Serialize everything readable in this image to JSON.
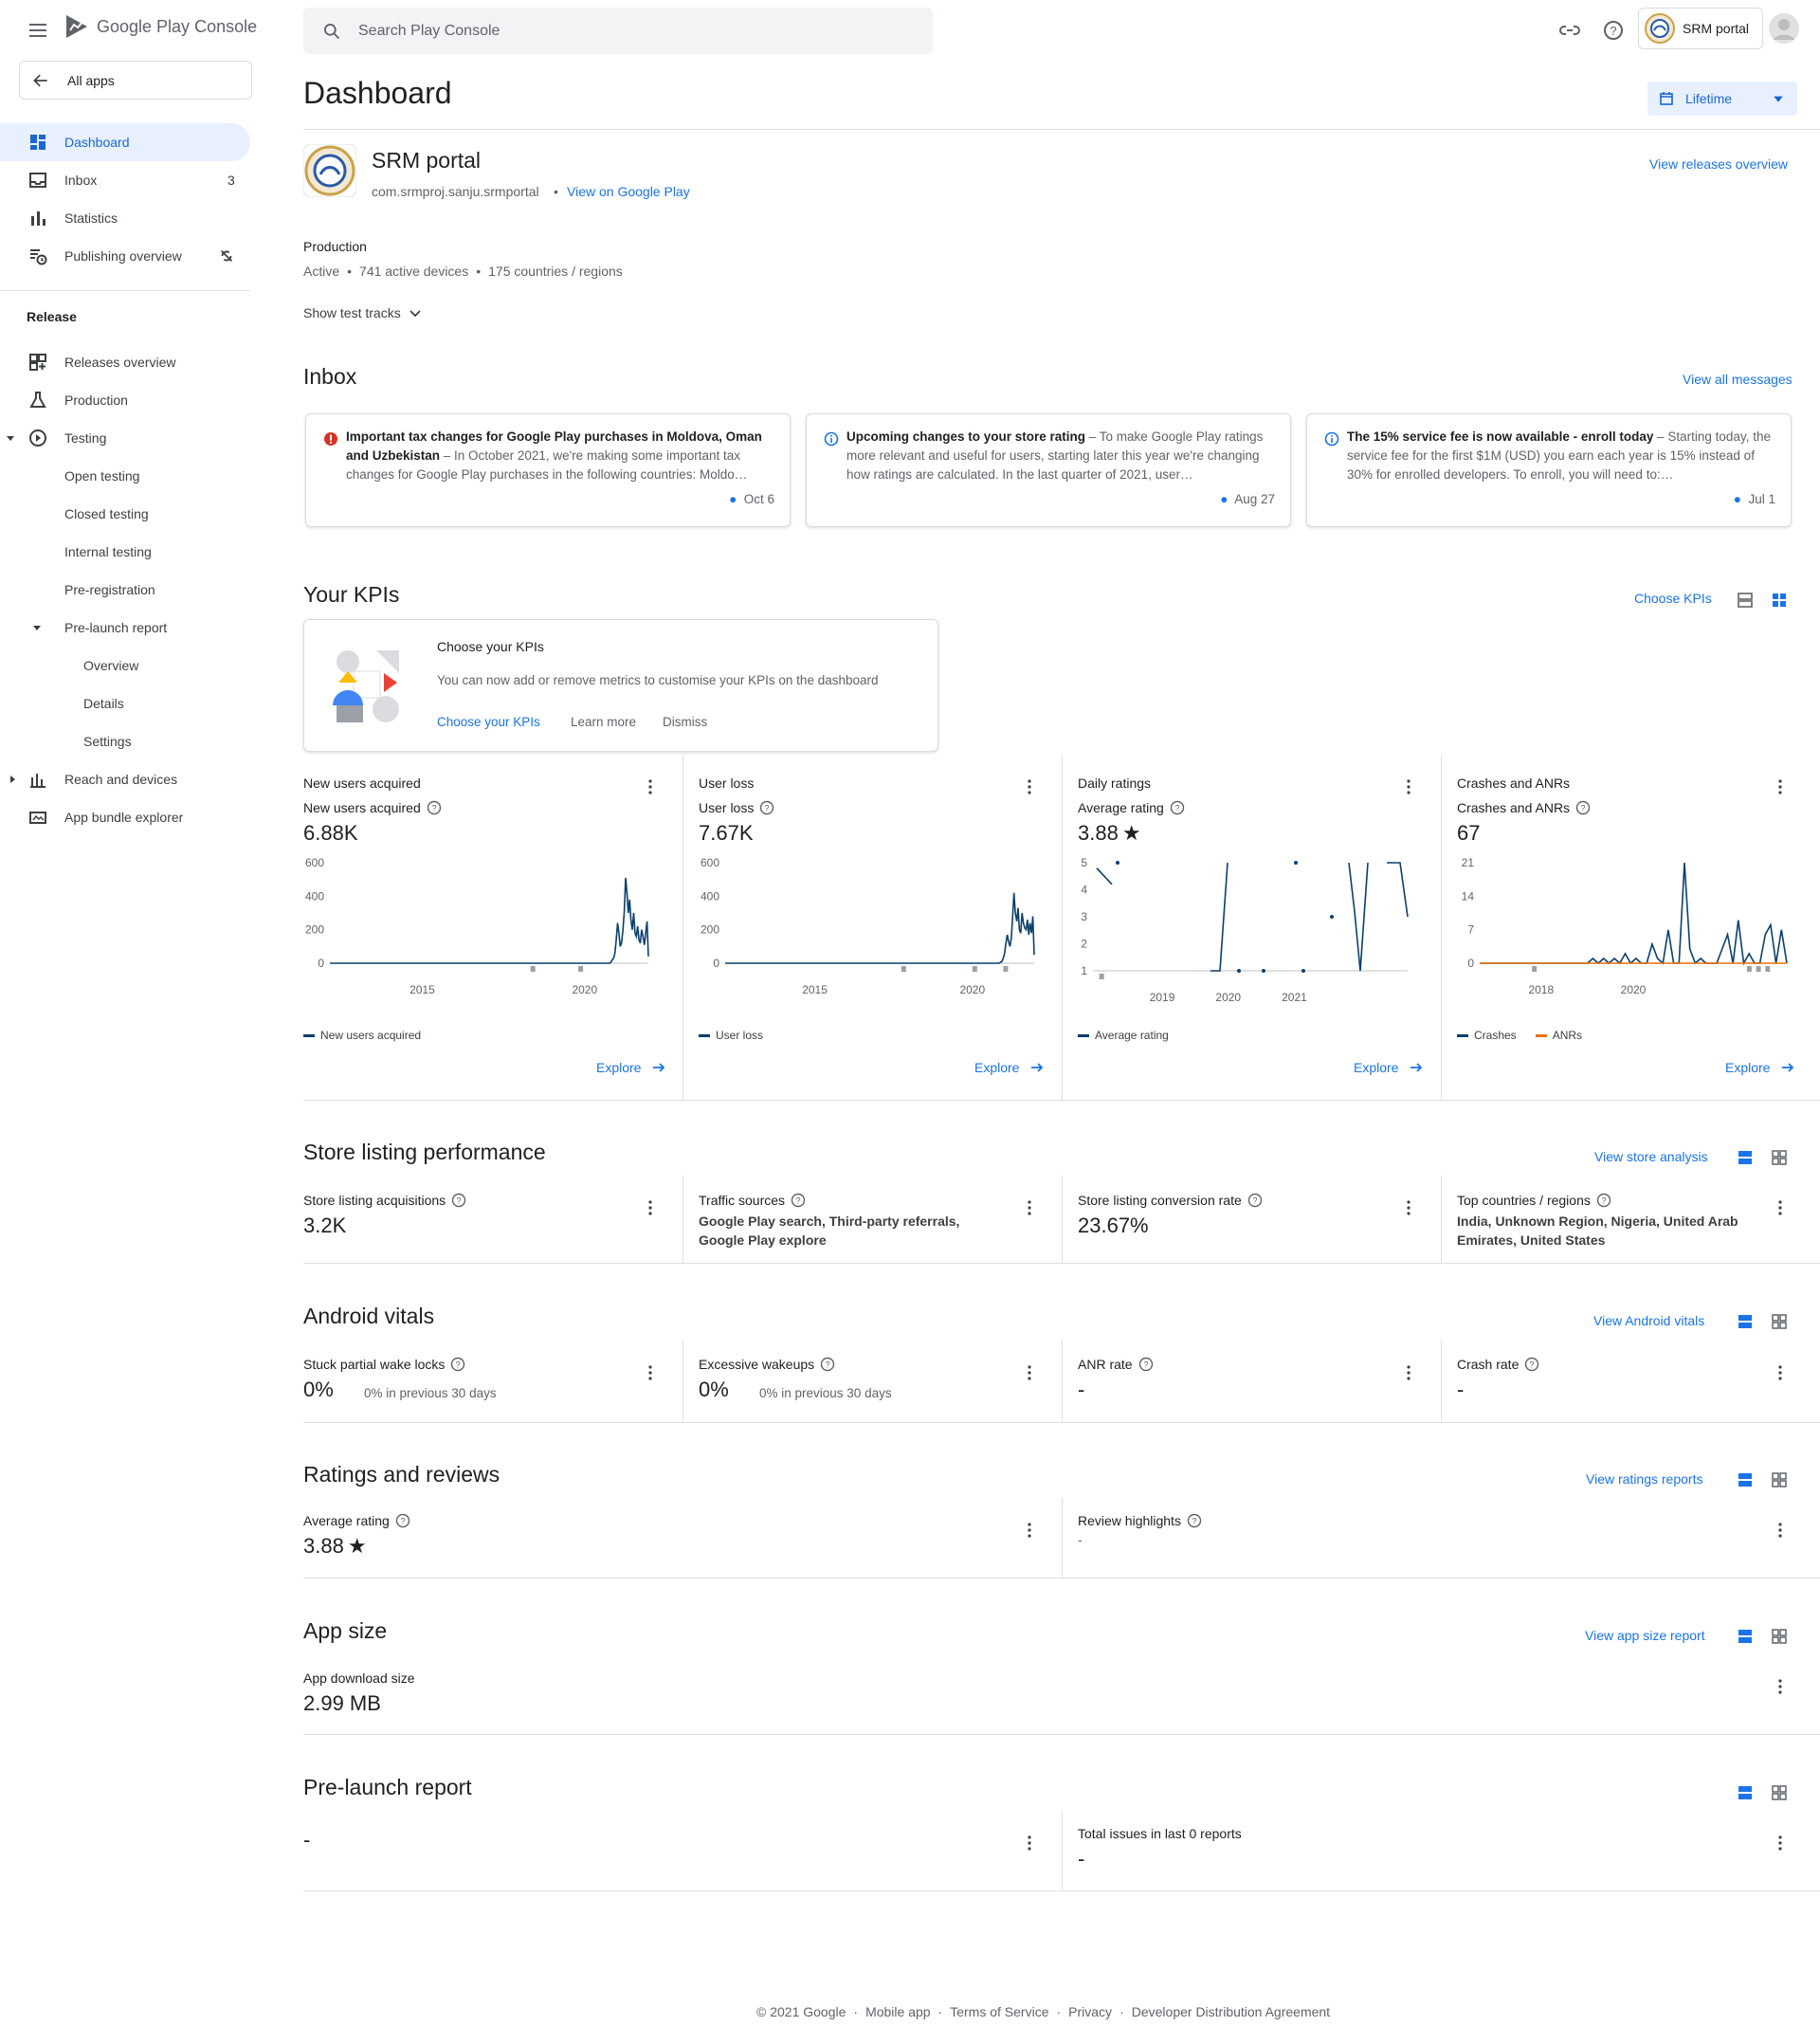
{
  "header": {
    "logo_text": "Google Play",
    "logo_text2": "Console",
    "search_placeholder": "Search Play Console",
    "account_name": "SRM portal"
  },
  "sidebar": {
    "all_apps": "All apps",
    "items": [
      {
        "label": "Dashboard",
        "icon": "dashboard-icon"
      },
      {
        "label": "Inbox",
        "icon": "inbox-icon",
        "count": "3"
      },
      {
        "label": "Statistics",
        "icon": "statistics-icon"
      },
      {
        "label": "Publishing overview",
        "icon": "publishing-icon"
      }
    ],
    "release_header": "Release",
    "release_items": [
      {
        "label": "Releases overview"
      },
      {
        "label": "Production"
      },
      {
        "label": "Testing"
      },
      {
        "label": "Open testing"
      },
      {
        "label": "Closed testing"
      },
      {
        "label": "Internal testing"
      },
      {
        "label": "Pre-registration"
      },
      {
        "label": "Pre-launch report"
      },
      {
        "label": "Overview"
      },
      {
        "label": "Details"
      },
      {
        "label": "Settings"
      },
      {
        "label": "Reach and devices"
      },
      {
        "label": "App bundle explorer"
      }
    ]
  },
  "page": {
    "title": "Dashboard",
    "date_range": "Lifetime"
  },
  "app": {
    "name": "SRM portal",
    "package": "com.srmproj.sanju.srmportal",
    "view_on_play": "View on Google Play",
    "view_releases": "View releases overview",
    "track": "Production",
    "status": "Active",
    "devices": "741 active devices",
    "countries": "175 countries / regions",
    "show_test_tracks": "Show test tracks"
  },
  "inbox": {
    "title": "Inbox",
    "view_all": "View all messages",
    "messages": [
      {
        "title": "Important tax changes for Google Play purchases in Moldova, Oman and Uzbekistan",
        "body": " – In October 2021, we're making some important tax changes for Google Play purchases in the following countries: Moldo…",
        "date": "Oct 6",
        "type": "error"
      },
      {
        "title": "Upcoming changes to your store rating",
        "body": " – To make Google Play ratings more relevant and useful for users, starting later this year we're changing how ratings are calculated. In the last quarter of 2021, user…",
        "date": "Aug 27",
        "type": "info"
      },
      {
        "title": "The 15% service fee is now available - enroll today",
        "body": " – Starting today, the service fee for the first $1M (USD) you earn each year is 15% instead of 30% for enrolled developers. To enroll, you will need to:…",
        "date": "Jul 1",
        "type": "info"
      }
    ]
  },
  "kpis": {
    "title": "Your KPIs",
    "choose_link": "Choose KPIs",
    "promo_title": "Choose your KPIs",
    "promo_body": "You can now add or remove metrics to customise your KPIs on the dashboard",
    "promo_choose": "Choose your KPIs",
    "promo_learn": "Learn more",
    "promo_dismiss": "Dismiss",
    "explore": "Explore",
    "cards": [
      {
        "title": "New users acquired",
        "metric": "New users acquired",
        "value": "6.88K",
        "legend": [
          "New users acquired"
        ]
      },
      {
        "title": "User loss",
        "metric": "User loss",
        "value": "7.67K",
        "legend": [
          "User loss"
        ]
      },
      {
        "title": "Daily ratings",
        "metric": "Average rating",
        "value": "3.88",
        "legend": [
          "Average rating"
        ]
      },
      {
        "title": "Crashes and ANRs",
        "metric": "Crashes and ANRs",
        "value": "67",
        "legend": [
          "Crashes",
          "ANRs"
        ]
      }
    ]
  },
  "chart_data": [
    {
      "type": "line",
      "title": "New users acquired",
      "yticks": [
        "600",
        "400",
        "200",
        "0"
      ],
      "xticks": [
        "2015",
        "2020"
      ],
      "ylim": [
        0,
        600
      ],
      "series": [
        {
          "name": "New users acquired",
          "values": [
            0,
            0,
            0,
            0,
            0,
            0,
            0,
            0,
            0,
            0,
            0,
            0,
            0,
            0,
            0,
            0,
            0,
            0,
            0,
            0,
            0,
            0,
            0,
            0,
            0,
            0,
            0,
            0,
            0,
            0,
            0,
            0,
            0,
            0,
            0,
            0,
            0,
            0,
            0,
            0,
            0,
            0,
            0,
            0,
            0,
            0,
            0,
            0,
            0,
            0,
            0,
            0,
            0,
            0,
            0,
            0,
            0,
            0,
            0,
            0,
            5,
            20,
            30,
            60,
            140,
            240,
            180,
            100,
            120,
            200,
            310,
            510,
            420,
            300,
            380,
            260,
            200,
            300,
            180,
            160,
            220,
            140,
            120,
            200,
            160,
            110,
            180,
            250,
            40
          ]
        }
      ]
    },
    {
      "type": "line",
      "title": "User loss",
      "yticks": [
        "600",
        "400",
        "200",
        "0"
      ],
      "xticks": [
        "2015",
        "2020"
      ],
      "ylim": [
        0,
        600
      ],
      "series": [
        {
          "name": "User loss",
          "values": [
            0,
            0,
            0,
            0,
            0,
            0,
            0,
            0,
            0,
            0,
            0,
            0,
            0,
            0,
            0,
            0,
            0,
            0,
            0,
            0,
            0,
            0,
            0,
            0,
            0,
            0,
            0,
            0,
            0,
            0,
            0,
            0,
            0,
            0,
            0,
            0,
            0,
            0,
            0,
            0,
            0,
            0,
            0,
            0,
            0,
            0,
            0,
            0,
            0,
            0,
            0,
            0,
            0,
            0,
            0,
            0,
            0,
            0,
            0,
            0,
            5,
            10,
            30,
            60,
            120,
            170,
            130,
            100,
            150,
            280,
            420,
            300,
            250,
            330,
            200,
            180,
            300,
            240,
            210,
            200,
            260,
            170,
            240,
            180,
            280,
            50
          ]
        }
      ]
    },
    {
      "type": "line",
      "title": "Average rating",
      "yticks": [
        "5",
        "4",
        "3",
        "2",
        "1"
      ],
      "xticks": [
        "2019",
        "2020",
        "2021"
      ],
      "ylim": [
        1,
        5
      ],
      "series": [
        {
          "name": "Average rating",
          "values": [
            4.8,
            4.4,
            4.2
          ]
        }
      ]
    },
    {
      "type": "line",
      "title": "Crashes and ANRs",
      "yticks": [
        "21",
        "14",
        "7",
        "0"
      ],
      "xticks": [
        "2018",
        "2020"
      ],
      "ylim": [
        0,
        21
      ],
      "series": [
        {
          "name": "Crashes",
          "values": [
            0,
            0,
            0,
            0,
            0,
            0,
            0,
            0,
            0,
            0,
            0,
            0,
            0,
            0,
            0,
            0,
            0,
            0,
            0,
            0,
            0,
            1,
            0,
            1,
            0,
            1,
            0,
            2,
            0,
            1,
            0,
            0,
            4,
            1,
            0,
            7,
            0,
            0,
            21,
            3,
            0,
            1,
            0,
            0,
            0,
            3,
            6,
            0,
            9,
            0,
            2,
            0,
            0,
            6,
            8,
            0,
            7,
            0
          ]
        },
        {
          "name": "ANRs",
          "values": [
            0,
            0,
            0,
            0,
            0,
            0,
            0,
            0,
            0,
            0,
            0,
            0,
            0,
            0,
            0,
            0,
            0,
            0,
            0,
            0,
            0,
            0,
            0,
            0,
            0,
            0,
            0,
            0,
            0,
            0,
            0,
            0,
            0,
            0,
            0,
            0,
            0,
            0,
            0,
            0,
            0,
            0,
            0,
            0,
            0,
            0,
            0,
            0,
            0,
            0,
            0,
            0,
            0,
            0,
            0,
            0,
            0,
            0
          ]
        }
      ]
    }
  ],
  "store_listing": {
    "title": "Store listing performance",
    "link": "View store analysis",
    "metrics": [
      {
        "title": "Store listing acquisitions",
        "value": "3.2K"
      },
      {
        "title": "Traffic sources",
        "value": "Google Play search, Third-party referrals, Google Play explore"
      },
      {
        "title": "Store listing conversion rate",
        "value": "23.67%"
      },
      {
        "title": "Top countries / regions",
        "value": "India, Unknown Region, Nigeria, United Arab Emirates, United States"
      }
    ]
  },
  "vitals": {
    "title": "Android vitals",
    "link": "View Android vitals",
    "metrics": [
      {
        "title": "Stuck partial wake locks",
        "value": "0%",
        "sub": "0% in previous 30 days"
      },
      {
        "title": "Excessive wakeups",
        "value": "0%",
        "sub": "0% in previous 30 days"
      },
      {
        "title": "ANR rate",
        "value": "-"
      },
      {
        "title": "Crash rate",
        "value": "-"
      }
    ]
  },
  "ratings": {
    "title": "Ratings and reviews",
    "link": "View ratings reports",
    "avg_title": "Average rating",
    "avg_value": "3.88",
    "highlights_title": "Review highlights",
    "highlights_value": "-"
  },
  "app_size": {
    "title": "App size",
    "link": "View app size report",
    "metric_title": "App download size",
    "value": "2.99 MB"
  },
  "prelaunch": {
    "title": "Pre-launch report",
    "left_value": "-",
    "right_title": "Total issues in last 0 reports",
    "right_value": "-"
  },
  "footer": {
    "copyright": "© 2021 Google",
    "links": [
      "Mobile app",
      "Terms of Service",
      "Privacy",
      "Developer Distribution Agreement"
    ]
  },
  "colors": {
    "accent": "#1a73e8",
    "chart_line": "#0b3f6e",
    "anr": "#e8710a",
    "error": "#d93025"
  }
}
